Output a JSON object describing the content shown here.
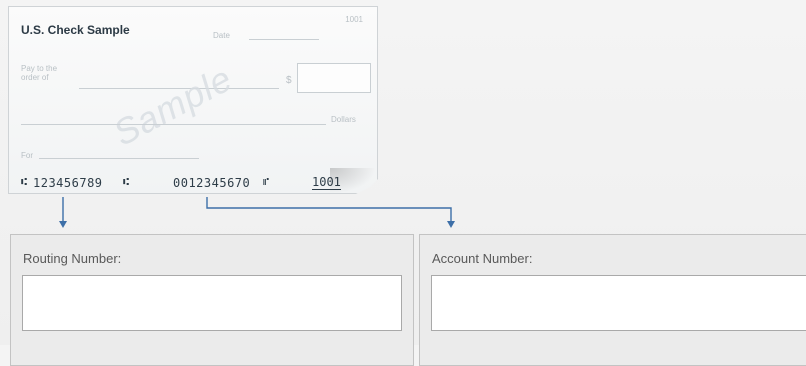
{
  "check": {
    "title": "U.S. Check Sample",
    "check_number_top": "1001",
    "date_label": "Date",
    "pay_to_label": "Pay to the order of",
    "dollar_sign": "$",
    "dollars_label": "Dollars",
    "for_label": "For",
    "watermark": "Sample",
    "routing_number": "123456789",
    "account_number": "0012345670",
    "check_number": "1001",
    "micr_transit_symbol": "⑆",
    "micr_onus_symbol": "⑈"
  },
  "routing": {
    "label": "Routing Number:",
    "value": "",
    "placeholder": ""
  },
  "account": {
    "label": "Account Number:",
    "value": "",
    "placeholder": ""
  },
  "colors": {
    "connector": "#3d6fa8",
    "micr_text": "#2e3d48",
    "field_label": "#595959"
  }
}
